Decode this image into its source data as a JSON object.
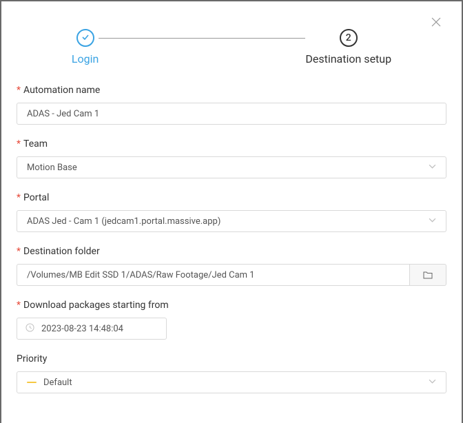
{
  "stepper": {
    "step1_label": "Login",
    "step2_label": "Destination setup",
    "step2_num": "2"
  },
  "fields": {
    "automation_name": {
      "label": "Automation name",
      "value": "ADAS - Jed Cam 1"
    },
    "team": {
      "label": "Team",
      "value": "Motion Base"
    },
    "portal": {
      "label": "Portal",
      "value": "ADAS Jed - Cam 1 (jedcam1.portal.massive.app)"
    },
    "destination_folder": {
      "label": "Destination folder",
      "value": "/Volumes/MB Edit SSD 1/ADAS/Raw Footage/Jed Cam 1"
    },
    "download_from": {
      "label": "Download packages starting from",
      "value": "2023-08-23 14:48:04"
    },
    "priority": {
      "label": "Priority",
      "value": "Default"
    }
  }
}
